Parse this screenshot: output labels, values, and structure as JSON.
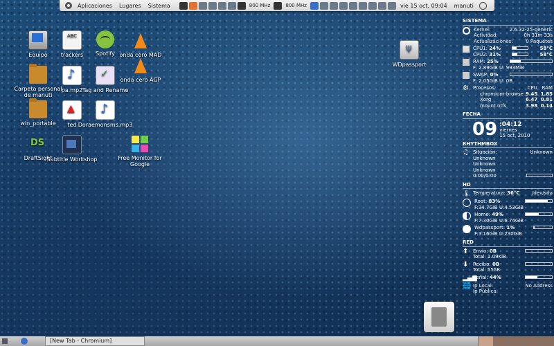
{
  "top_panel": {
    "menu": [
      "Aplicaciones",
      "Lugares",
      "Sistema"
    ],
    "cpu_freq_1": "800 MHz",
    "cpu_freq_2": "800 MHz",
    "clock": "vie 15 oct, 09:04",
    "user": "manuti"
  },
  "desktop_icons": [
    {
      "label": "Equipo"
    },
    {
      "label": "trackers"
    },
    {
      "label": "Spotify"
    },
    {
      "label": "onda cero MAD"
    },
    {
      "label": "Carpeta personal de manuti"
    },
    {
      "label": "pa.mp2"
    },
    {
      "label": "Tag and Rename"
    },
    {
      "label": "onda cero AGP"
    },
    {
      "label": "win_portable"
    },
    {
      "label": "ted"
    },
    {
      "label": "Doraemonsms.mp3"
    },
    {
      "label": "DraftSight"
    },
    {
      "label": "Subtitle Workshop"
    },
    {
      "label": "Free Monitor for Google"
    },
    {
      "label": "WDpassport"
    }
  ],
  "conky": {
    "sistema": {
      "title": "SISTEMA",
      "kernel_label": "Kernel:",
      "kernel": "2.6.32-25-generic",
      "actividad_label": "Actividad:",
      "actividad": "0h 31m 33s",
      "actualizaciones_label": "Actualizaciones:",
      "actualizaciones": "0 Paquetes",
      "cpu1_label": "CPU1:",
      "cpu1": "24%",
      "cpu1_temp": "58°C",
      "cpu1_pct": 24,
      "cpu2_label": "CPU2:",
      "cpu2": "31%",
      "cpu2_temp": "58°C",
      "cpu2_pct": 31,
      "ram_label": "RAM:",
      "ram": "25%",
      "ram_pct": 25,
      "ram_detail": "F: 2.89GiB U: 993MiB",
      "swap_label": "SWAP:",
      "swap": "0%",
      "swap_pct": 0,
      "swap_detail": "F: 2.05GiB U: 0B",
      "procesos_label": "Procesos:",
      "proc_cpu_h": "CPU",
      "proc_ram_h": "RAM",
      "procesos": [
        {
          "name": "chromium-browse",
          "cpu": "9.45",
          "ram": "1.85"
        },
        {
          "name": "Xorg",
          "cpu": "6.47",
          "ram": "0.81"
        },
        {
          "name": "mount.ntfs",
          "cpu": "3.98",
          "ram": "0.14"
        }
      ]
    },
    "fecha": {
      "title": "FECHA",
      "day": "09",
      "time": ":04:12",
      "weekday": "viernes",
      "date": "15 oct, 2010"
    },
    "rhythmbox": {
      "title": "RHYTHMBOX",
      "situacion_label": "Situación:",
      "situacion": "Unknown",
      "line1": "Unknown",
      "line2": "Unknown",
      "line3": "Unknown",
      "progress": "0:00/0:00"
    },
    "hd": {
      "title": "HD",
      "temp_label": "Temperatura:",
      "temp": "36°C",
      "device": "/dev/sda",
      "root_label": "Root:",
      "root": "83%",
      "root_pct": 83,
      "root_detail": "F:34.7GiB U:4.53GiB",
      "home_label": "Home:",
      "home": "49%",
      "home_pct": 49,
      "home_detail": "F:7.30GiB U:6.74GiB",
      "wd_label": "Wdpassport:",
      "wd": "1%",
      "wd_pct": 1,
      "wd_detail": "F:3.16GiB U:230GiB"
    },
    "red": {
      "title": "RED",
      "envio_label": "Envio:",
      "envio": "0B",
      "envio_total": "Total: 1.09KiB",
      "recibo_label": "Recibo:",
      "recibo": "0B",
      "recibo_total": "Total: 555B",
      "senal_label": "Señal:",
      "senal": "44%",
      "senal_pct": 44,
      "ip_local_label": "Ip Local:",
      "ip_local": "No Address",
      "ip_publica_label": "Ip Pública:"
    }
  },
  "bottom_panel": {
    "task": "[New Tab - Chromium]",
    "workspaces": 5
  }
}
